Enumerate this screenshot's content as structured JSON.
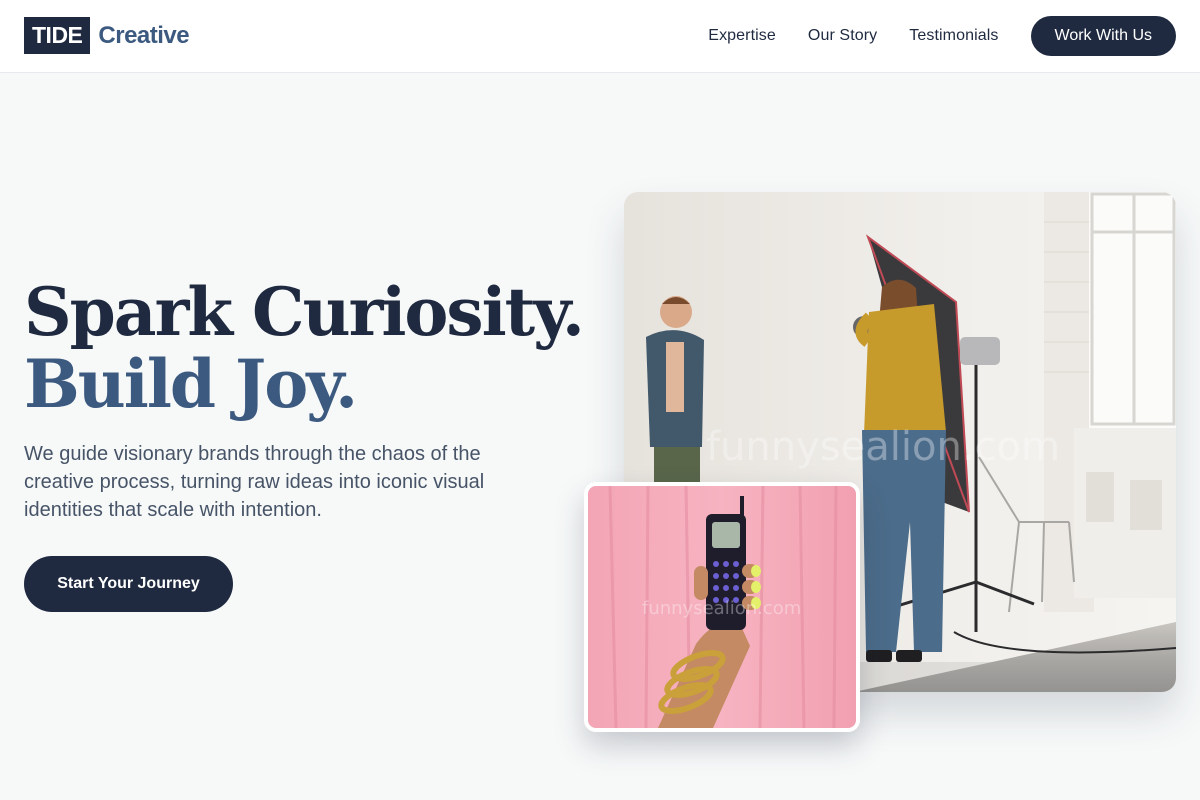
{
  "brand": {
    "mark": "TIDE",
    "name": "Creative"
  },
  "nav": {
    "items": [
      {
        "label": "Expertise"
      },
      {
        "label": "Our Story"
      },
      {
        "label": "Testimonials"
      }
    ],
    "cta_label": "Work With Us"
  },
  "hero": {
    "headline_line1": "Spark Curiosity.",
    "headline_line2": "Build Joy.",
    "description": "We guide visionary brands through the chaos of the creative process, turning raw ideas into iconic visual identities that scale with intention.",
    "cta_label": "Start Your Journey"
  },
  "colors": {
    "primary": "#1f2a40",
    "accent": "#3c5a80",
    "background": "#f7f9f9"
  }
}
